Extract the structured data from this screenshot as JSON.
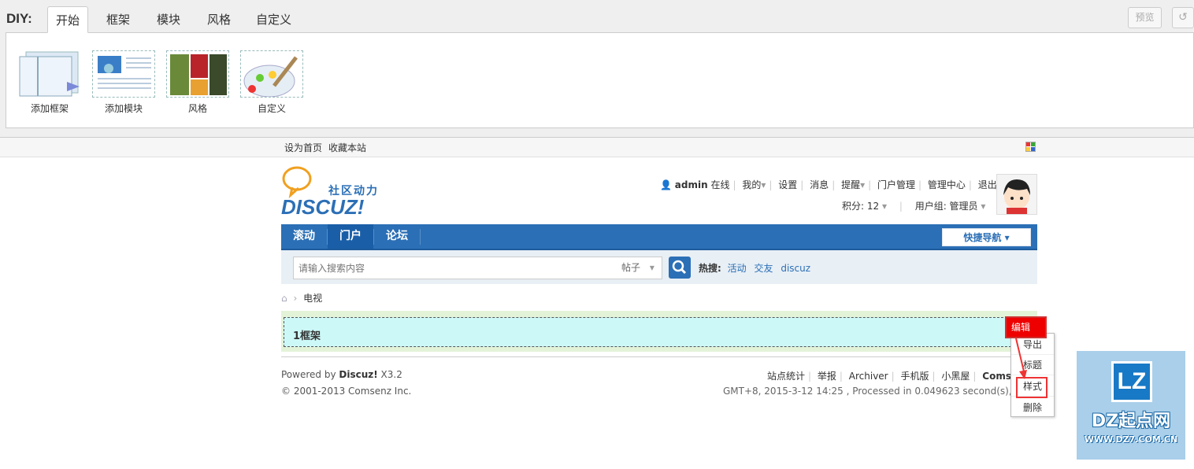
{
  "diy": {
    "label": "DIY:",
    "tabs": [
      "开始",
      "框架",
      "模块",
      "风格",
      "自定义"
    ],
    "tools": [
      "添加框架",
      "添加模块",
      "风格",
      "自定义"
    ],
    "preview_label": "预览",
    "undo_icon": "undo-icon"
  },
  "topbar": {
    "set_home": "设为首页",
    "bookmark": "收藏本站"
  },
  "logo": {
    "tagline": "社区动力",
    "brand": "DISCUZ!"
  },
  "userbar": {
    "username": "admin",
    "online": "在线",
    "links": [
      "我的",
      "设置",
      "消息",
      "提醒",
      "门户管理",
      "管理中心",
      "退出"
    ],
    "points": "积分: 12",
    "group": "用户组: 管理员"
  },
  "nav": {
    "items": [
      "滚动",
      "门户",
      "论坛"
    ],
    "quick": "快捷导航"
  },
  "search": {
    "placeholder": "请输入搜索内容",
    "type": "帖子",
    "hot_label": "热搜:",
    "hot_words": [
      "活动",
      "交友",
      "discuz"
    ]
  },
  "breadcrumb": {
    "current": "电视"
  },
  "frame": {
    "title": "1框架",
    "edit_label": "编辑",
    "menu": [
      "导出",
      "标题",
      "样式",
      "删除"
    ]
  },
  "footer": {
    "powered_prefix": "Powered by ",
    "powered_brand": "Discuz!",
    "powered_version": " X3.2",
    "copyright": "© 2001-2013 Comsenz Inc.",
    "links": [
      "站点统计",
      "举报",
      "Archiver",
      "手机版",
      "小黑屋",
      "Comsenz"
    ],
    "stats": "GMT+8, 2015-3-12 14:25 , Processed in 0.049623 second(s), 8 queries ."
  },
  "watermark": {
    "logo_text": "LZ",
    "name": "DZ起点网",
    "url": "WWW.DZ7.COM.CN"
  },
  "colors": {
    "nav_blue": "#2b6fb6",
    "frame_bg": "#cdf8f8",
    "edit_red": "#ee0000"
  }
}
